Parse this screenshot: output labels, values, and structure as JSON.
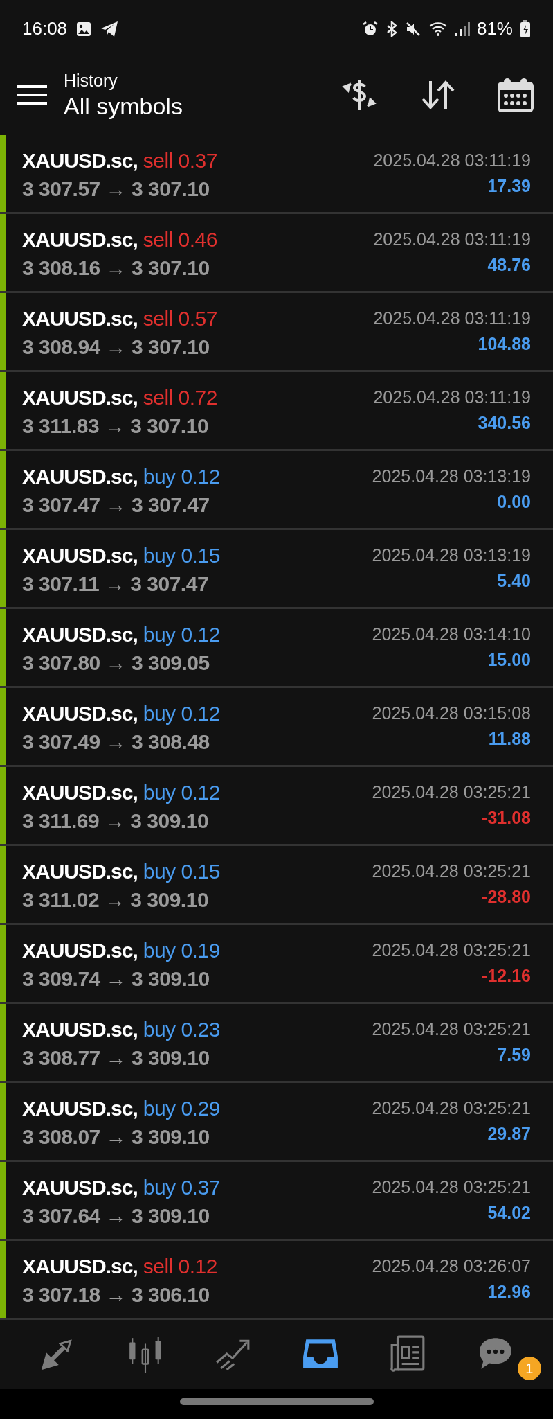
{
  "status_bar": {
    "time": "16:08",
    "battery": "81%"
  },
  "header": {
    "title": "History",
    "subtitle": "All symbols"
  },
  "deals": [
    {
      "symbol": "XAUUSD.sc,",
      "type": "sell",
      "volume": "0.37",
      "prices": "3 307.57 → 3 307.10",
      "time": "2025.04.28 03:11:19",
      "profit": "17.39",
      "loss": false
    },
    {
      "symbol": "XAUUSD.sc,",
      "type": "sell",
      "volume": "0.46",
      "prices": "3 308.16 → 3 307.10",
      "time": "2025.04.28 03:11:19",
      "profit": "48.76",
      "loss": false
    },
    {
      "symbol": "XAUUSD.sc,",
      "type": "sell",
      "volume": "0.57",
      "prices": "3 308.94 → 3 307.10",
      "time": "2025.04.28 03:11:19",
      "profit": "104.88",
      "loss": false
    },
    {
      "symbol": "XAUUSD.sc,",
      "type": "sell",
      "volume": "0.72",
      "prices": "3 311.83 → 3 307.10",
      "time": "2025.04.28 03:11:19",
      "profit": "340.56",
      "loss": false
    },
    {
      "symbol": "XAUUSD.sc,",
      "type": "buy",
      "volume": "0.12",
      "prices": "3 307.47 → 3 307.47",
      "time": "2025.04.28 03:13:19",
      "profit": "0.00",
      "loss": false
    },
    {
      "symbol": "XAUUSD.sc,",
      "type": "buy",
      "volume": "0.15",
      "prices": "3 307.11 → 3 307.47",
      "time": "2025.04.28 03:13:19",
      "profit": "5.40",
      "loss": false
    },
    {
      "symbol": "XAUUSD.sc,",
      "type": "buy",
      "volume": "0.12",
      "prices": "3 307.80 → 3 309.05",
      "time": "2025.04.28 03:14:10",
      "profit": "15.00",
      "loss": false
    },
    {
      "symbol": "XAUUSD.sc,",
      "type": "buy",
      "volume": "0.12",
      "prices": "3 307.49 → 3 308.48",
      "time": "2025.04.28 03:15:08",
      "profit": "11.88",
      "loss": false
    },
    {
      "symbol": "XAUUSD.sc,",
      "type": "buy",
      "volume": "0.12",
      "prices": "3 311.69 → 3 309.10",
      "time": "2025.04.28 03:25:21",
      "profit": "-31.08",
      "loss": true
    },
    {
      "symbol": "XAUUSD.sc,",
      "type": "buy",
      "volume": "0.15",
      "prices": "3 311.02 → 3 309.10",
      "time": "2025.04.28 03:25:21",
      "profit": "-28.80",
      "loss": true
    },
    {
      "symbol": "XAUUSD.sc,",
      "type": "buy",
      "volume": "0.19",
      "prices": "3 309.74 → 3 309.10",
      "time": "2025.04.28 03:25:21",
      "profit": "-12.16",
      "loss": true
    },
    {
      "symbol": "XAUUSD.sc,",
      "type": "buy",
      "volume": "0.23",
      "prices": "3 308.77 → 3 309.10",
      "time": "2025.04.28 03:25:21",
      "profit": "7.59",
      "loss": false
    },
    {
      "symbol": "XAUUSD.sc,",
      "type": "buy",
      "volume": "0.29",
      "prices": "3 308.07 → 3 309.10",
      "time": "2025.04.28 03:25:21",
      "profit": "29.87",
      "loss": false
    },
    {
      "symbol": "XAUUSD.sc,",
      "type": "buy",
      "volume": "0.37",
      "prices": "3 307.64 → 3 309.10",
      "time": "2025.04.28 03:25:21",
      "profit": "54.02",
      "loss": false
    },
    {
      "symbol": "XAUUSD.sc,",
      "type": "sell",
      "volume": "0.12",
      "prices": "3 307.18 → 3 306.10",
      "time": "2025.04.28 03:26:07",
      "profit": "12.96",
      "loss": false
    }
  ],
  "nav": [
    {
      "kind": "quotes",
      "selected": false
    },
    {
      "kind": "chart",
      "selected": false
    },
    {
      "kind": "trade",
      "selected": false
    },
    {
      "kind": "history",
      "selected": true
    },
    {
      "kind": "news",
      "selected": false
    },
    {
      "kind": "chat",
      "selected": false,
      "badge": "1"
    }
  ]
}
